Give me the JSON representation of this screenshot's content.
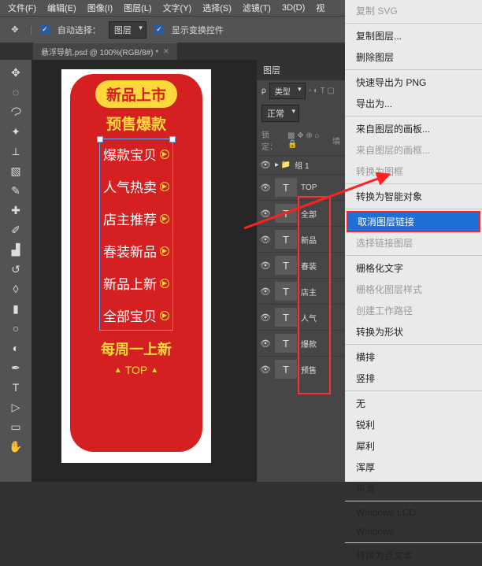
{
  "menubar": [
    "文件(F)",
    "编辑(E)",
    "图像(I)",
    "图层(L)",
    "文字(Y)",
    "选择(S)",
    "滤镜(T)",
    "3D(D)",
    "视"
  ],
  "optbar": {
    "auto_select_label": "自动选择：",
    "target": "图层",
    "show_transform": "显示变换控件"
  },
  "doc_tab": "悬浮导航.psd @ 100%(RGB/8#) *",
  "nav": {
    "header": "新品上市",
    "sub": "预售爆款",
    "items": [
      "爆款宝贝",
      "人气热卖",
      "店主推荐",
      "春装新品",
      "新品上新",
      "全部宝贝"
    ],
    "footer": "每周一上新",
    "top": "TOP"
  },
  "layers_panel": {
    "title": "图层",
    "kind_label": "类型",
    "blend": "正常",
    "lock_label": "锁定：",
    "fill_label": "填",
    "group": "组 1",
    "layers": [
      "TOP",
      "全部",
      "新品",
      "春装",
      "店主",
      "人气",
      "爆款",
      "预售"
    ]
  },
  "ctx": {
    "copy_svg": "复制 SVG",
    "dup": "复制图层...",
    "del": "删除图层",
    "export_png": "快速导出为 PNG",
    "export_as": "导出为...",
    "artboard_from": "来自图层的画板...",
    "frame_from": "来自图层的画框...",
    "to_frame": "转换为图框",
    "smart": "转换为智能对象",
    "unlink": "取消图层链接",
    "sel_linked": "选择链接图层",
    "raster_text": "栅格化文字",
    "raster_style": "栅格化图层样式",
    "work_path": "创建工作路径",
    "to_shape": "转换为形状",
    "horiz": "横排",
    "vert": "竖排",
    "none": "无",
    "sharp": "锐利",
    "crisp": "犀利",
    "strong": "浑厚",
    "smooth": "平滑",
    "lcd": "Windows LCD",
    "win": "Windows",
    "to_point": "转换为点文本"
  }
}
